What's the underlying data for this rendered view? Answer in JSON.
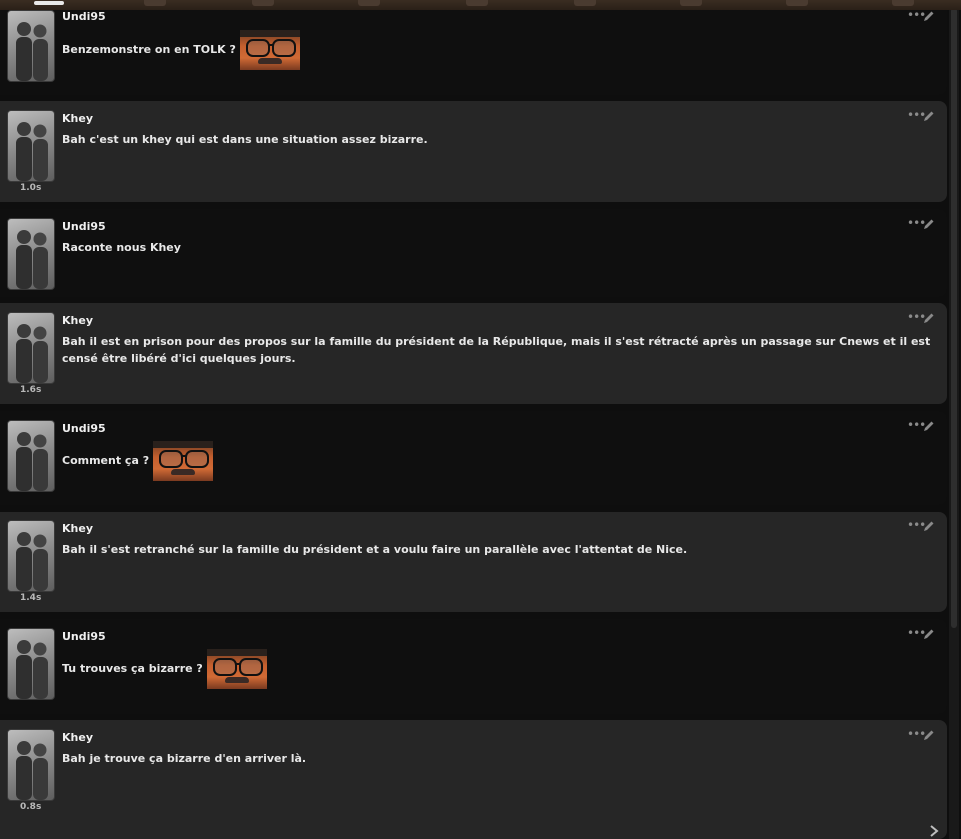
{
  "top_nav": {
    "icons": [
      "settings-icon",
      "api-icon",
      "extensions-icon",
      "persona-icon",
      "world-info-icon",
      "backgrounds-icon",
      "characters-icon",
      "user-icon",
      "char-list-icon"
    ]
  },
  "messages": [
    {
      "sender": "Undi95",
      "role": "user",
      "text": "Benzemonstre on en TOLK ?",
      "emote": true
    },
    {
      "sender": "Khey",
      "role": "bot",
      "text": "Bah c'est un khey qui est dans une situation assez bizarre.",
      "timing": "1.0s"
    },
    {
      "sender": "Undi95",
      "role": "user",
      "text": "Raconte nous Khey"
    },
    {
      "sender": "Khey",
      "role": "bot",
      "text": "Bah il est en prison pour des propos sur la famille du président de la République, mais il s'est rétracté après un passage sur Cnews et il est censé être libéré d'ici quelques jours.",
      "timing": "1.6s"
    },
    {
      "sender": "Undi95",
      "role": "user",
      "text": "Comment ça ?",
      "emote": true
    },
    {
      "sender": "Khey",
      "role": "bot",
      "text": "Bah il s'est retranché sur la famille du président et a voulu faire un parallèle avec l'attentat de Nice.",
      "timing": "1.4s"
    },
    {
      "sender": "Undi95",
      "role": "user",
      "text": "Tu trouves ça bizarre ?",
      "emote": true
    },
    {
      "sender": "Khey",
      "role": "bot",
      "text": "Bah je trouve ça bizarre d'en arriver là.",
      "timing": "0.8s"
    }
  ],
  "message_tools": {
    "more_icon": "ellipsis-icon",
    "edit_icon": "pencil-icon"
  },
  "colors": {
    "bot_bg": "#262626",
    "user_bg": "#0f0f0f",
    "page_bg": "#0e0e0e",
    "topbar": "#3a2d22"
  }
}
